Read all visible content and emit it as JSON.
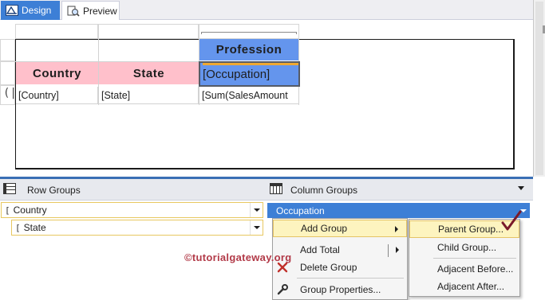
{
  "tabs": {
    "design_label": "Design",
    "preview_label": "Preview"
  },
  "tablix": {
    "column_group_header": "Profession",
    "headers": {
      "country": "Country",
      "state": "State",
      "occupation": "[Occupation]"
    },
    "detail_row": {
      "country": "[Country]",
      "state": "[State]",
      "value": "[Sum(SalesAmount"
    }
  },
  "grouping_pane": {
    "row_groups_label": "Row Groups",
    "column_groups_label": "Column Groups",
    "row_groups": [
      {
        "label": "Country"
      },
      {
        "label": "State"
      }
    ],
    "column_groups": [
      {
        "label": "Occupation"
      }
    ]
  },
  "context_menu": {
    "items": [
      {
        "label": "Add Group",
        "highlighted": true,
        "has_submenu": true
      },
      {
        "label": "Add Total",
        "has_submenu": true
      },
      {
        "label": "Delete Group",
        "icon": "delete-icon"
      },
      {
        "label": "Group Properties...",
        "icon": "wrench-icon"
      }
    ]
  },
  "submenu": {
    "items": [
      {
        "label": "Parent Group...",
        "highlighted": true
      },
      {
        "label": "Child Group..."
      },
      {
        "label": "Adjacent Before..."
      },
      {
        "label": "Adjacent After..."
      }
    ]
  },
  "watermark": "©tutorialgateway.org",
  "colors": {
    "accent": "#3d7fd6",
    "header_pink": "#ffc0cb",
    "header_blue": "#6495ed",
    "menu_highlight": "#fdf4bf",
    "watermark": "#b23a48",
    "checkmark": "#7a1a2a"
  }
}
